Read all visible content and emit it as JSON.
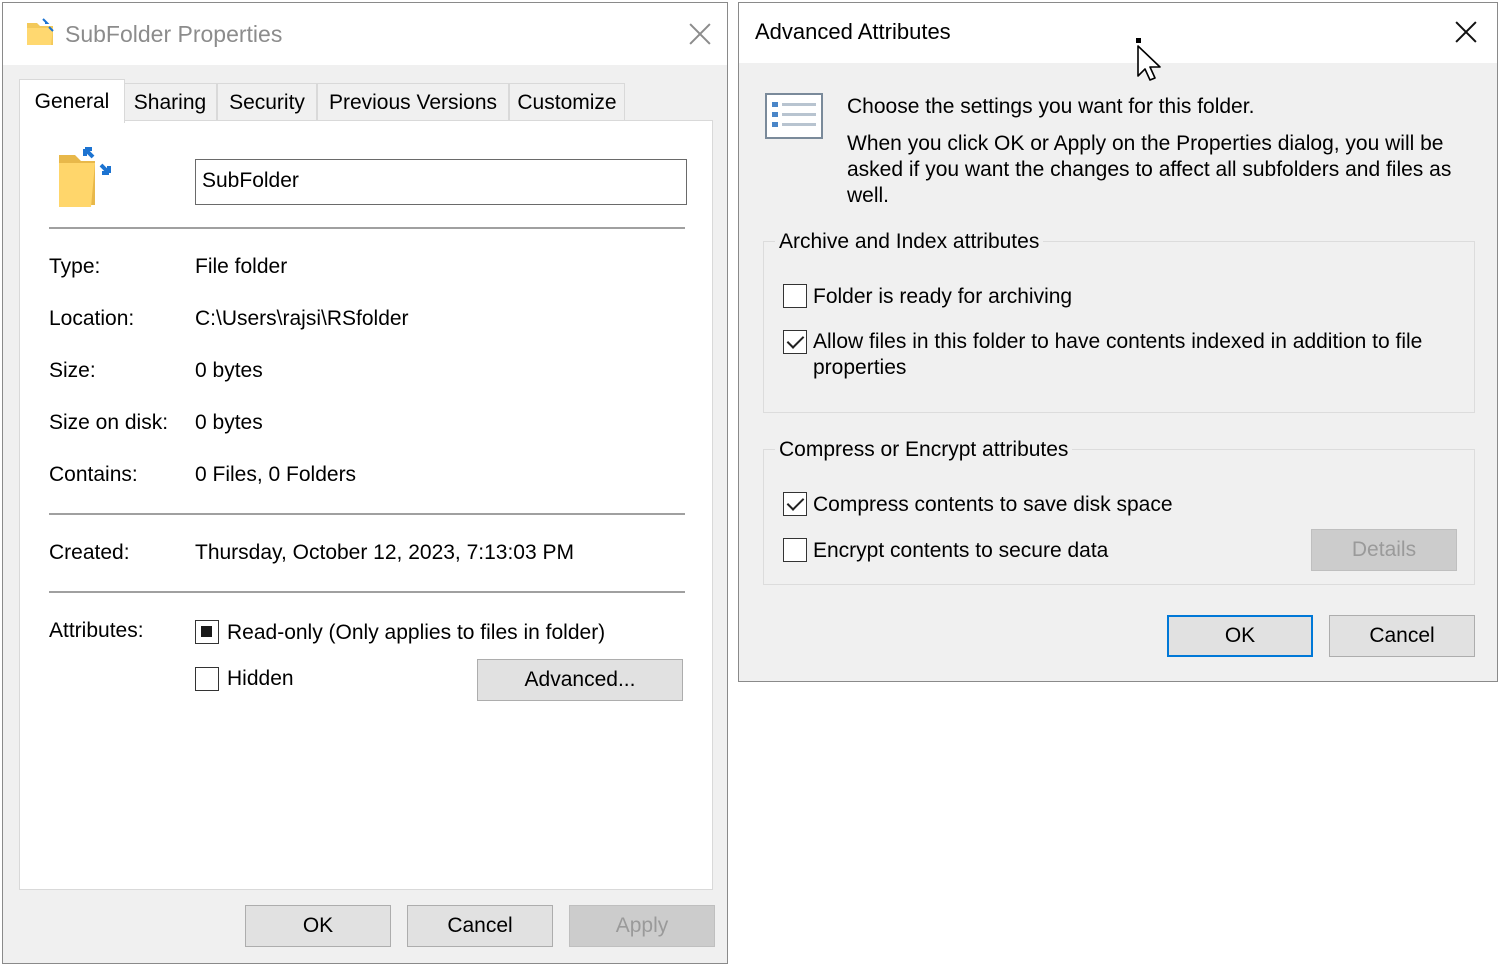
{
  "properties_window": {
    "title": "SubFolder Properties",
    "tabs": [
      "General",
      "Sharing",
      "Security",
      "Previous Versions",
      "Customize"
    ],
    "active_tab": "General",
    "name_value": "SubFolder",
    "fields": {
      "type_label": "Type:",
      "type_value": "File folder",
      "location_label": "Location:",
      "location_value": "C:\\Users\\rajsi\\RSfolder",
      "size_label": "Size:",
      "size_value": "0 bytes",
      "size_on_disk_label": "Size on disk:",
      "size_on_disk_value": "0 bytes",
      "contains_label": "Contains:",
      "contains_value": "0 Files, 0 Folders",
      "created_label": "Created:",
      "created_value": "Thursday, October 12, 2023, 7:13:03 PM",
      "attributes_label": "Attributes:"
    },
    "readonly_label": "Read-only (Only applies to files in folder)",
    "hidden_label": "Hidden",
    "advanced_button": "Advanced...",
    "buttons": {
      "ok": "OK",
      "cancel": "Cancel",
      "apply": "Apply"
    }
  },
  "advanced_window": {
    "title": "Advanced Attributes",
    "intro_heading": "Choose the settings you want for this folder.",
    "intro_text": "When you click OK or Apply on the Properties dialog, you will be asked if you want the changes to affect all subfolders and files as well.",
    "archive_group": {
      "title": "Archive and Index attributes",
      "archive_label": "Folder is ready for archiving",
      "index_label": "Allow files in this folder to have contents indexed in addition to file properties"
    },
    "compress_group": {
      "title": "Compress or Encrypt attributes",
      "compress_label": "Compress contents to save disk space",
      "encrypt_label": "Encrypt contents to secure data",
      "details_button": "Details"
    },
    "buttons": {
      "ok": "OK",
      "cancel": "Cancel"
    }
  }
}
